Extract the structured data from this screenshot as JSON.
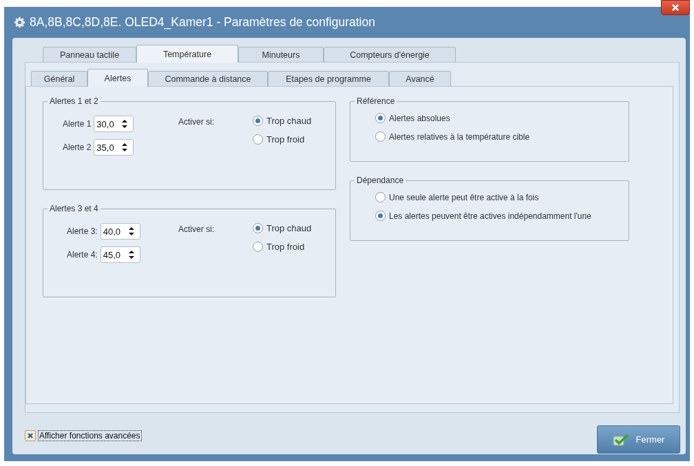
{
  "window": {
    "title": "8A,8B,8C,8D,8E. OLED4_Kamer1 - Paramètres de configuration"
  },
  "tabs": [
    {
      "label": "Panneau tactile",
      "selected": false
    },
    {
      "label": "Température",
      "selected": true
    },
    {
      "label": "Minuteurs",
      "selected": false
    },
    {
      "label": "Compteurs d'énergie",
      "selected": false
    }
  ],
  "subtabs": [
    {
      "label": "Général",
      "selected": false
    },
    {
      "label": "Alertes",
      "selected": true
    },
    {
      "label": "Commande à distance",
      "selected": false
    },
    {
      "label": "Etapes de programme",
      "selected": false
    },
    {
      "label": "Avancé",
      "selected": false
    }
  ],
  "alert_groups": [
    {
      "title": "Alertes 1 et 2",
      "activate_label": "Activer si:",
      "spinners": [
        {
          "label": "Alerte 1",
          "value": "30,0"
        },
        {
          "label": "Alerte 2",
          "value": "35,0"
        }
      ],
      "radios": [
        {
          "label": "Trop chaud",
          "selected": true
        },
        {
          "label": "Trop froid",
          "selected": false
        }
      ]
    },
    {
      "title": "Alertes 3 et 4",
      "activate_label": "Activer si:",
      "spinners": [
        {
          "label": "Alerte 3:",
          "value": "40,0"
        },
        {
          "label": "Alerte 4:",
          "value": "45,0"
        }
      ],
      "radios": [
        {
          "label": "Trop chaud",
          "selected": true
        },
        {
          "label": "Trop froid",
          "selected": false
        }
      ]
    }
  ],
  "option_groups": [
    {
      "title": "Référence",
      "options": [
        {
          "label": "Alertes absolues",
          "selected": true
        },
        {
          "label": "Alertes relatives à la température cible",
          "selected": false
        }
      ]
    },
    {
      "title": "Dépendance",
      "options": [
        {
          "label": "Une seule alerte peut être active à la fois",
          "selected": false
        },
        {
          "label": "Les alertes peuvent être actives indépendamment l'une",
          "selected": true
        }
      ]
    }
  ],
  "advanced_checkbox": {
    "label": "Afficher fonctions avancées",
    "checked": true
  },
  "close_button": {
    "label": "Fermer"
  }
}
